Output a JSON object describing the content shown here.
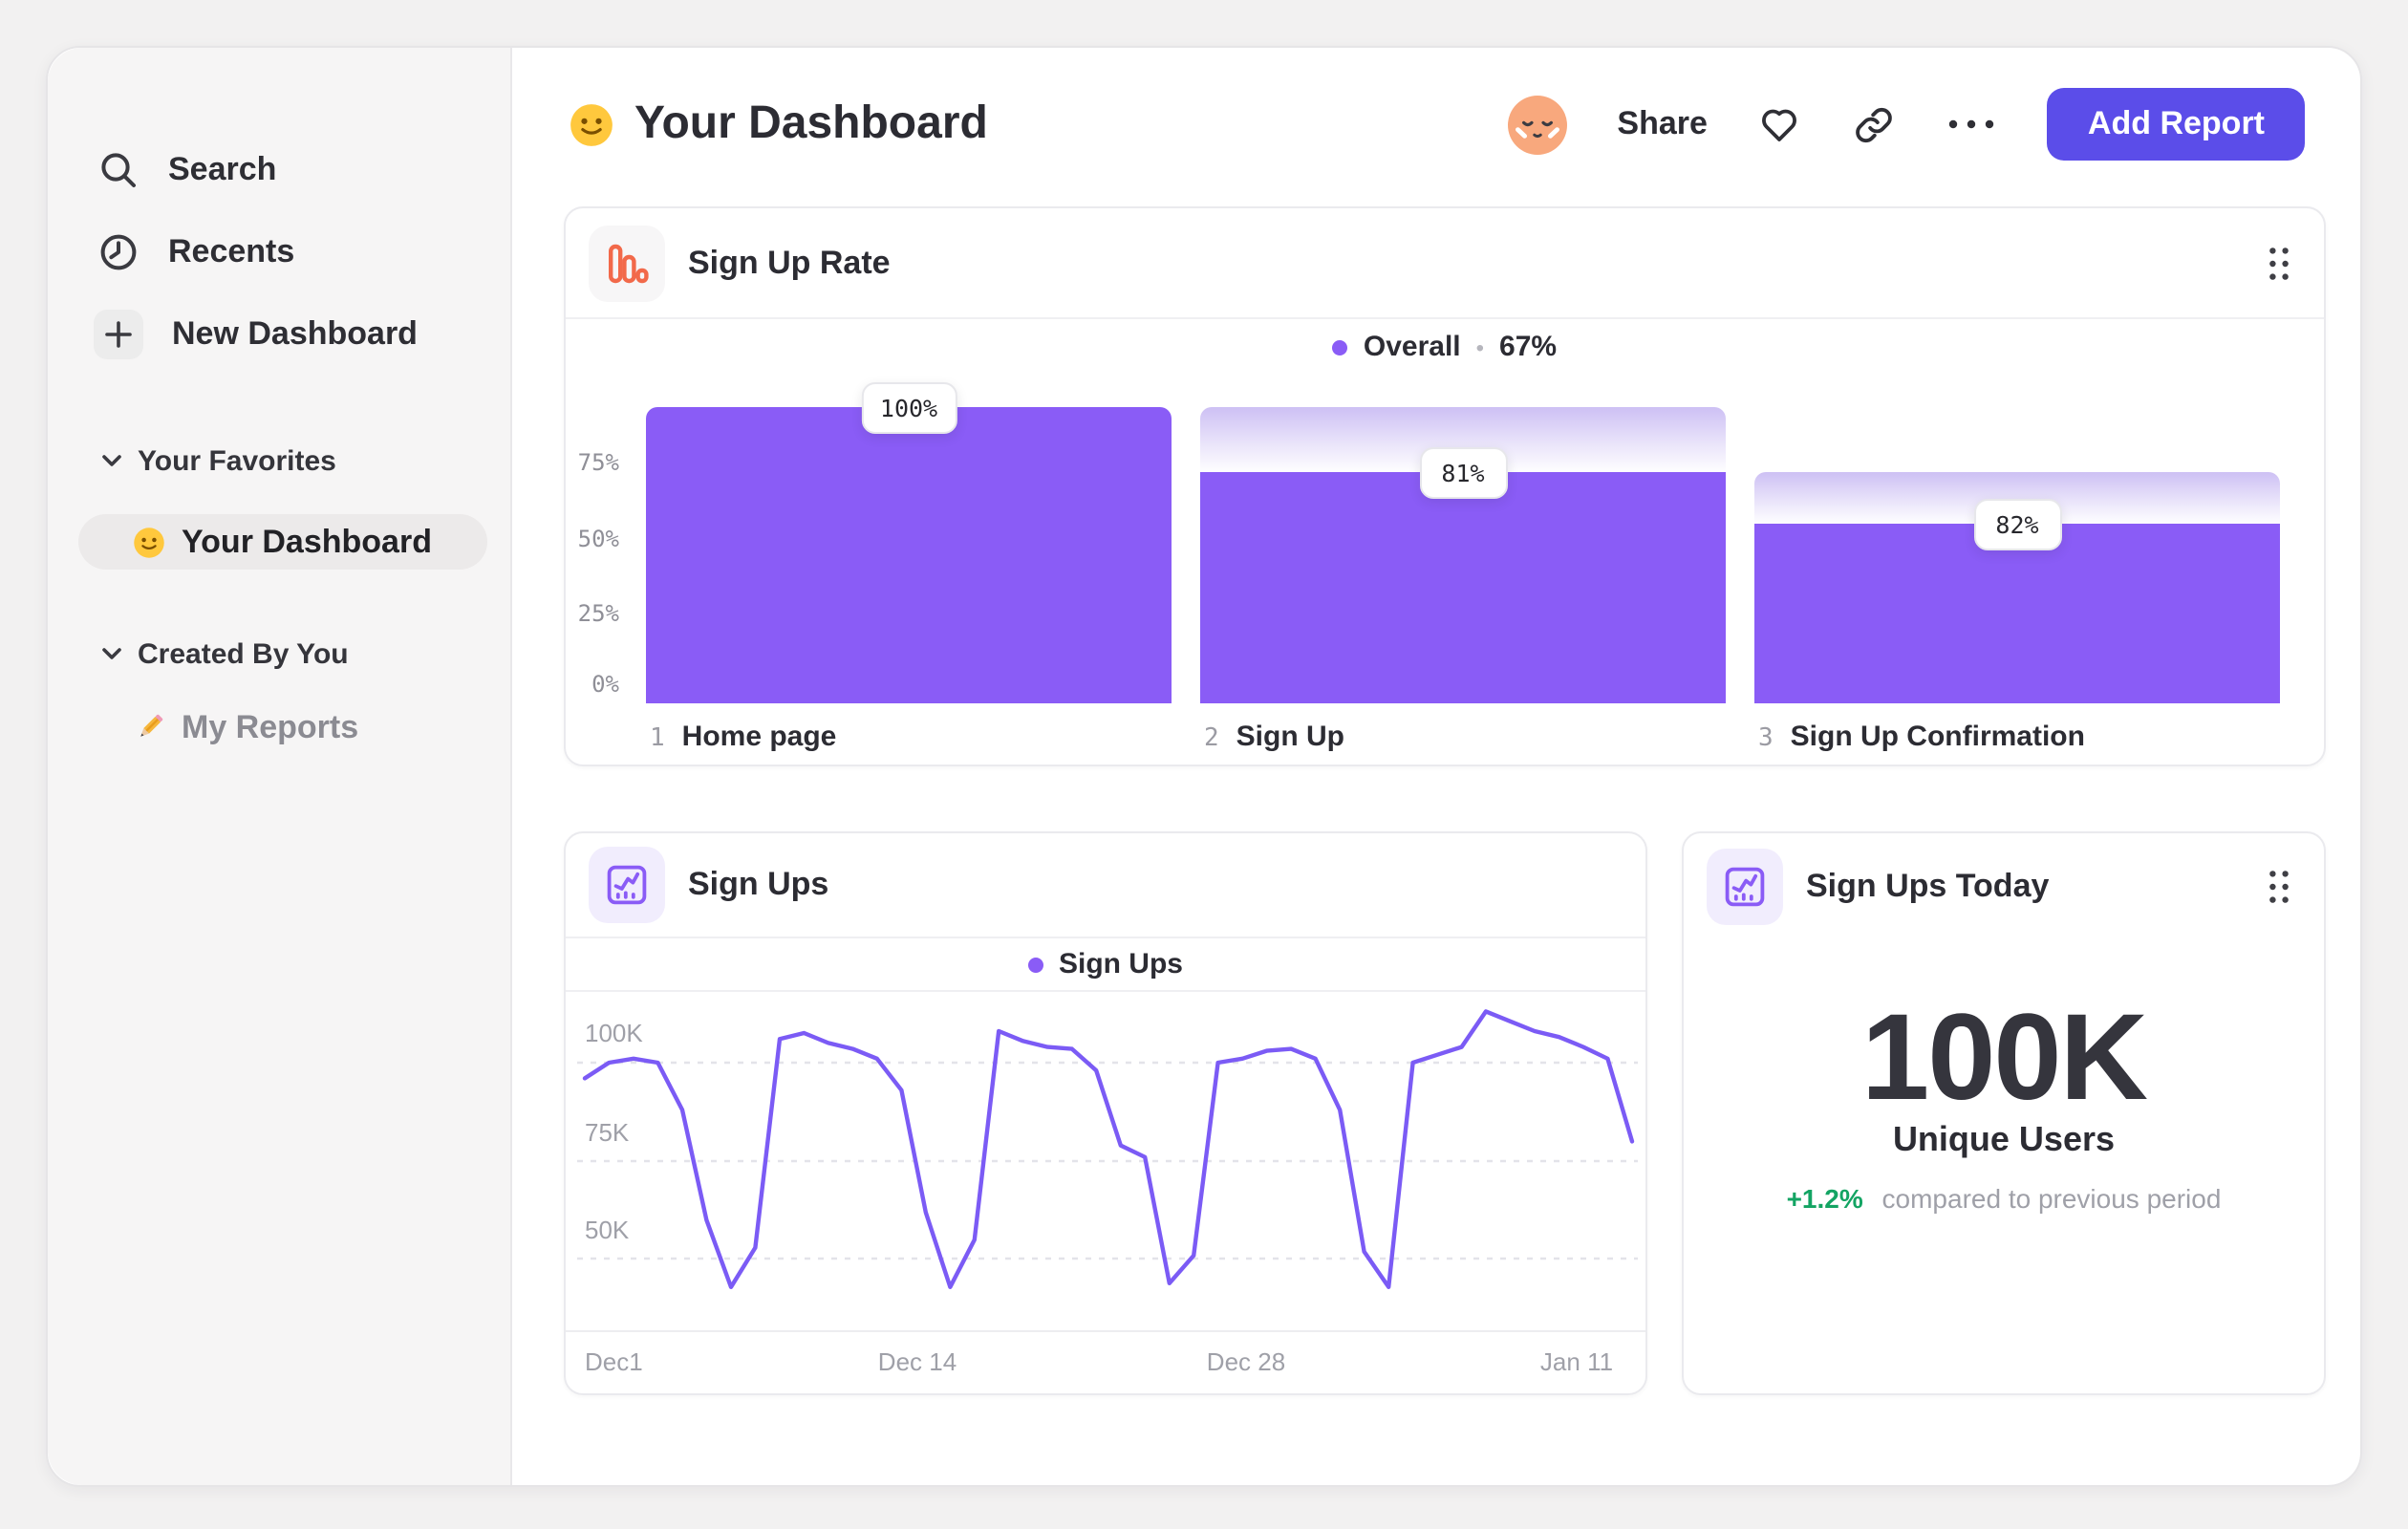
{
  "sidebar": {
    "search_label": "Search",
    "recents_label": "Recents",
    "new_dashboard_label": "New Dashboard",
    "favorites_header": "Your Favorites",
    "favorite_item_label": "Your Dashboard",
    "created_header": "Created By You",
    "created_item_label": "My Reports"
  },
  "header": {
    "title": "Your Dashboard",
    "share_label": "Share",
    "add_report_label": "Add Report"
  },
  "chart_data": [
    {
      "type": "bar",
      "variant": "funnel",
      "title": "Sign Up Rate",
      "legend_label": "Overall",
      "legend_separator": "•",
      "overall_value": "67%",
      "accent_color": "#8A5CF6",
      "y_ticks": [
        "75%",
        "50%",
        "25%",
        "0%"
      ],
      "ylim": [
        0,
        100
      ],
      "step_numbers": [
        "1",
        "2",
        "3"
      ],
      "categories": [
        "Home page",
        "Sign Up",
        "Sign Up Confirmation"
      ],
      "values": [
        100,
        81,
        82
      ],
      "value_labels": [
        "100%",
        "81%",
        "82%"
      ],
      "solid_heights_pct": [
        100,
        78,
        60.5
      ],
      "ghost_tops_pct": [
        100,
        100,
        78
      ]
    },
    {
      "type": "line",
      "title": "Sign Ups",
      "legend_label": "Sign Ups",
      "line_color": "#7B5BF5",
      "y_ticks": [
        "100K",
        "75K",
        "50K"
      ],
      "x_ticks": [
        "Dec1",
        "Dec 14",
        "Dec 28",
        "Jan 11"
      ],
      "x_range_days": [
        "Dec 1",
        "Jan 13"
      ],
      "unit": "K",
      "values": [
        96,
        100,
        101,
        100,
        88,
        60,
        43,
        53,
        106,
        107.5,
        105,
        103.5,
        101,
        93,
        62,
        43,
        55,
        108,
        105.5,
        104,
        103.5,
        98,
        79,
        76,
        44,
        51,
        100,
        101,
        103,
        103.5,
        101,
        88,
        52,
        43,
        100,
        102,
        104,
        113,
        110.5,
        108,
        106.5,
        104,
        101,
        80
      ]
    },
    {
      "type": "number",
      "title": "Sign Ups Today",
      "value": "100K",
      "value_label": "Unique Users",
      "delta": "+1.2%",
      "delta_color": "#13A463",
      "delta_note": "compared to previous period"
    }
  ]
}
